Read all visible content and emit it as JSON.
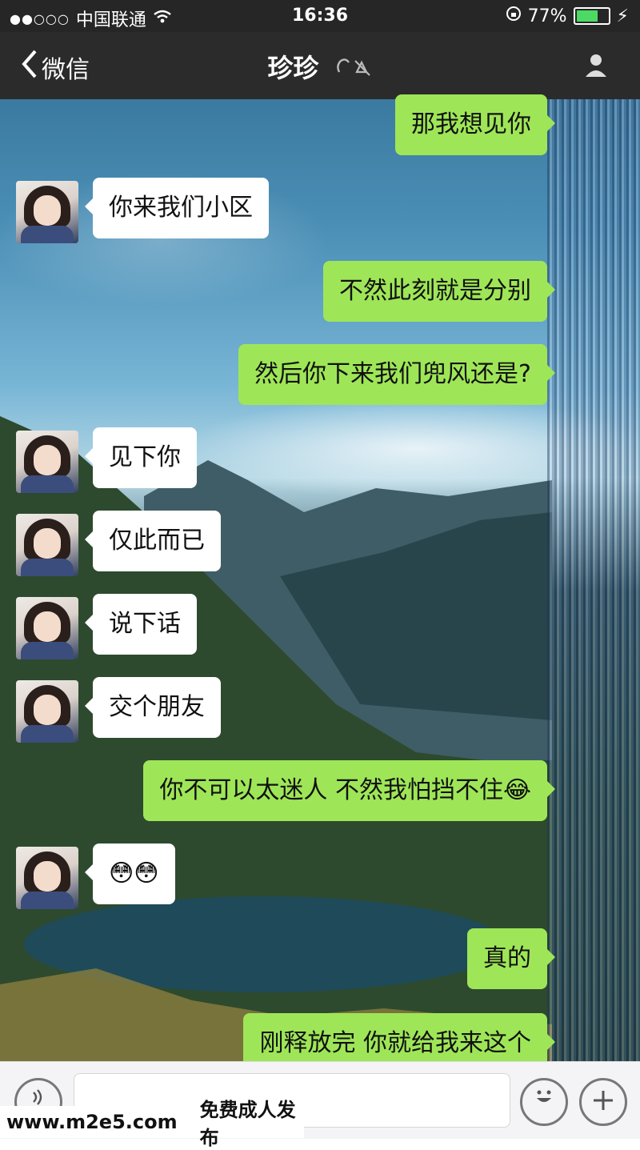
{
  "status_bar": {
    "signal": "●●○○○",
    "carrier": "中国联通",
    "time": "16:36",
    "battery": "77%",
    "battery_level": 0.77
  },
  "nav": {
    "back_label": "微信",
    "title": "珍珍"
  },
  "messages": [
    {
      "side": "out",
      "text": "那我想见你"
    },
    {
      "side": "in",
      "text": "你来我们小区"
    },
    {
      "side": "out",
      "text": "不然此刻就是分别"
    },
    {
      "side": "out",
      "text": "然后你下来我们兜风还是?"
    },
    {
      "side": "in",
      "text": "见下你"
    },
    {
      "side": "in",
      "text": "仅此而已"
    },
    {
      "side": "in",
      "text": "说下话"
    },
    {
      "side": "in",
      "text": "交个朋友"
    },
    {
      "side": "out",
      "text": "你不可以太迷人  不然我怕挡不住😂"
    },
    {
      "side": "in",
      "text": "😳😳"
    },
    {
      "side": "out",
      "text": "真的"
    },
    {
      "side": "out",
      "text": "刚释放完 你就给我来这个"
    }
  ],
  "watermark": {
    "url": "www.m2e5.com",
    "text": "免费成人发布"
  },
  "icons": {
    "back": "chevron-left-icon",
    "mute": "mute-icon",
    "profile": "profile-icon",
    "voice": "voice-icon",
    "emoji": "emoji-icon",
    "plus": "plus-icon"
  },
  "colors": {
    "outgoing_bubble": "#9ee657",
    "incoming_bubble": "#ffffff",
    "navbar": "#2b2b2b"
  }
}
